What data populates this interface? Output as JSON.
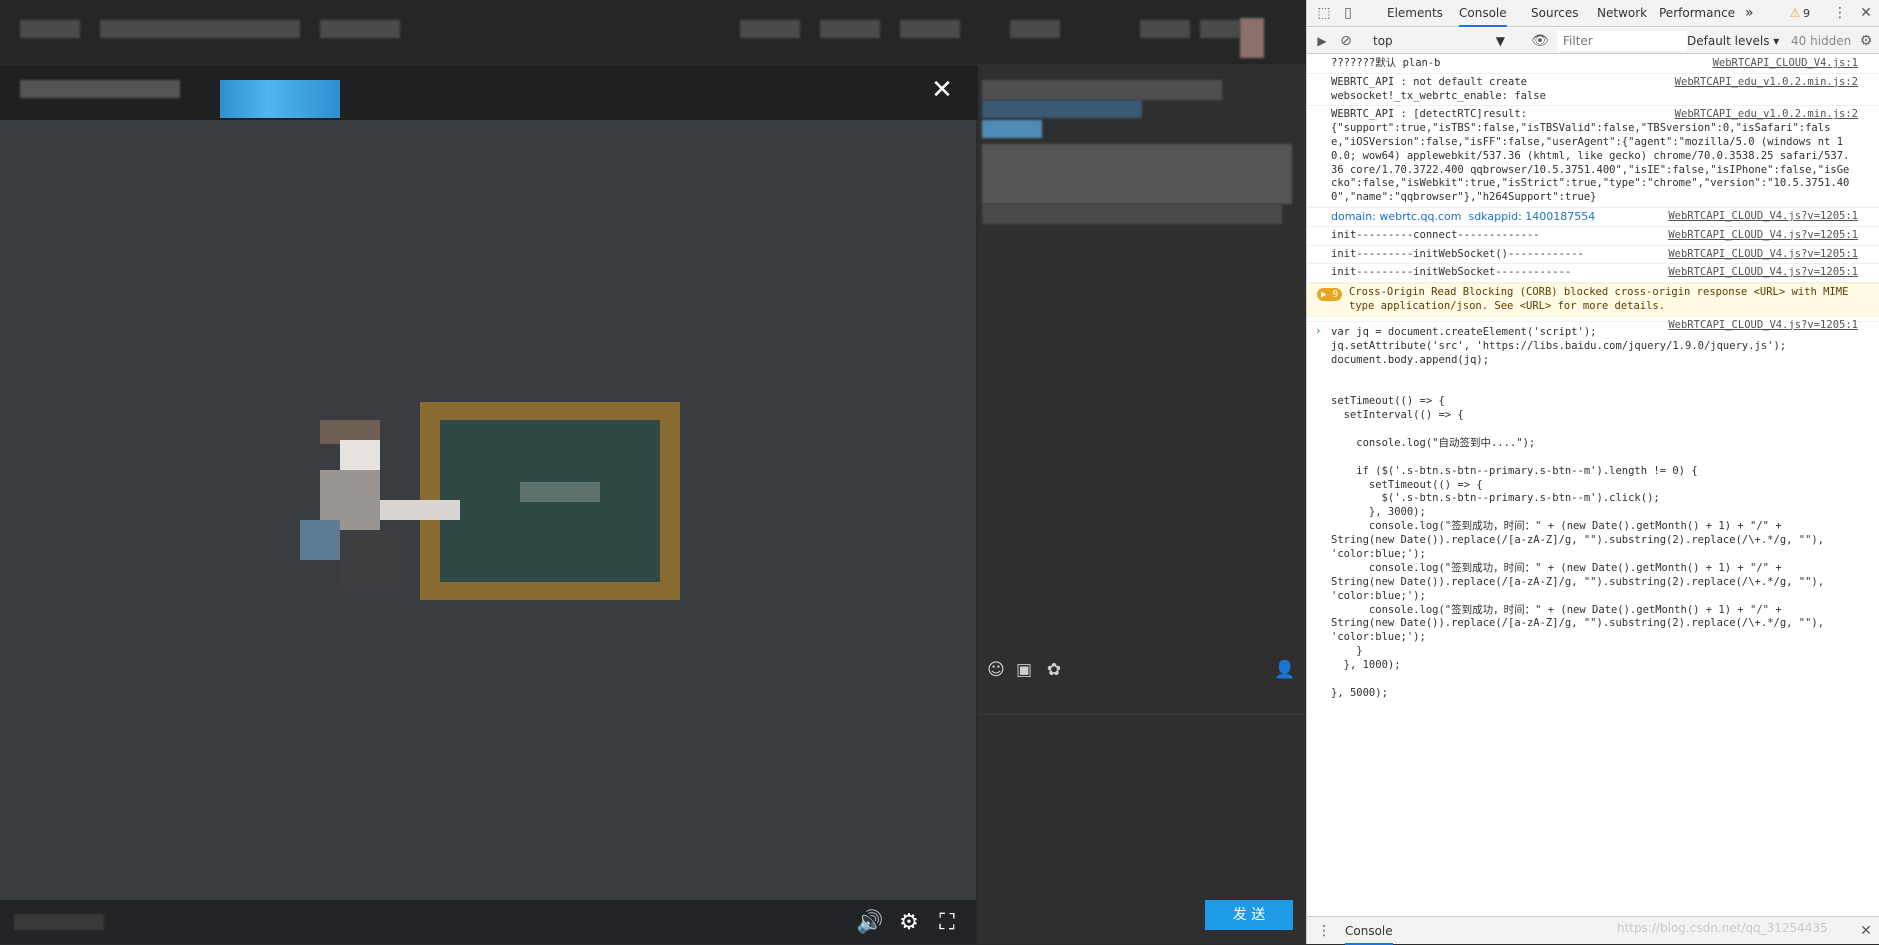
{
  "devtools": {
    "tabs": [
      "Elements",
      "Console",
      "Sources",
      "Network",
      "Performance"
    ],
    "more_tabs": "»",
    "warning_count": "9",
    "toolbar": {
      "context": "top",
      "filter_placeholder": "Filter",
      "levels": "Default levels ▾",
      "hidden": "40 hidden"
    },
    "messages": [
      {
        "text": "???????默认 plan-b",
        "source": "WebRTCAPI_CLOUD_V4.js:1"
      },
      {
        "text": "WEBRTC_API : not default create\nwebsocket!_tx_webrtc_enable: false",
        "source": "WebRTCAPI_edu_v1.0.2.min.js:2"
      },
      {
        "text": "WEBRTC_API : [detectRTC]result:\n{\"support\":true,\"isTBS\":false,\"isTBSValid\":false,\"TBSversion\":0,\"isSafari\":false,\"iOSVersion\":false,\"isFF\":false,\"userAgent\":{\"agent\":\"mozilla/5.0 (windows nt 10.0; wow64) applewebkit/537.36 (khtml, like gecko) chrome/70.0.3538.25 safari/537.36 core/1.70.3722.400 qqbrowser/10.5.3751.400\",\"isIE\":false,\"isIPhone\":false,\"isGecko\":false,\"isWebkit\":true,\"isStrict\":true,\"type\":\"chrome\",\"version\":\"10.5.3751.400\",\"name\":\"qqbrowser\"},\"h264Support\":true}",
        "source": "WebRTCAPI_edu_v1.0.2.min.js:2"
      },
      {
        "text": "domain: webrtc.qq.com  sdkappid: 1400187554",
        "source": "WebRTCAPI_CLOUD_V4.js?v=1205:1",
        "style": "blue"
      },
      {
        "text": "init---------connect-------------",
        "source": "WebRTCAPI_CLOUD_V4.js?v=1205:1"
      },
      {
        "text": "init---------initWebSocket()------------",
        "source": "WebRTCAPI_CLOUD_V4.js?v=1205:1"
      },
      {
        "text": "init---------initWebSocket------------",
        "source": "WebRTCAPI_CLOUD_V4.js?v=1205:1"
      },
      {
        "text": "Cross-Origin Read Blocking (CORB) blocked cross-origin response <URL> with MIME type application/json. See <URL> for more details.",
        "source": "",
        "style": "warn",
        "badge": "▶ 9"
      },
      {
        "text": "",
        "source": "WebRTCAPI_CLOUD_V4.js?v=1205:1"
      }
    ],
    "code_lines": [
      "var jq = document.createElement('script');",
      "jq.setAttribute('src', 'https://libs.baidu.com/jquery/1.9.0/jquery.js');",
      "document.body.append(jq);",
      "",
      "",
      "setTimeout(() => {",
      "  setInterval(() => {",
      "",
      "    console.log(\"自动签到中....\");",
      "",
      "    if ($('.s-btn.s-btn--primary.s-btn--m').length != 0) {",
      "      setTimeout(() => {",
      "        $('.s-btn.s-btn--primary.s-btn--m').click();",
      "      }, 3000);",
      "      console.log(\"签到成功，时间：\" + (new Date().getMonth() + 1) + \"/\" +",
      "String(new Date()).replace(/[a-zA-Z]/g, \"\").substring(2).replace(/\\+.*/g, \"\"),",
      "'color:blue;');",
      "      console.log(\"签到成功，时间：\" + (new Date().getMonth() + 1) + \"/\" +",
      "String(new Date()).replace(/[a-zA-Z]/g, \"\").substring(2).replace(/\\+.*/g, \"\"),",
      "'color:blue;');",
      "      console.log(\"签到成功，时间：\" + (new Date().getMonth() + 1) + \"/\" +",
      "String(new Date()).replace(/[a-zA-Z]/g, \"\").substring(2).replace(/\\+.*/g, \"\"),",
      "'color:blue;');",
      "    }",
      "  }, 1000);",
      "",
      "}, 5000);"
    ],
    "drawer_tab": "Console",
    "watermark": "https://blog.csdn.net/qq_31254435"
  },
  "page": {
    "close_label": "✕",
    "send_label": "发 送"
  },
  "colors": {
    "accent": "#1e9be6",
    "devtools_active": "#1a73e8",
    "warning": "#e7a520"
  }
}
